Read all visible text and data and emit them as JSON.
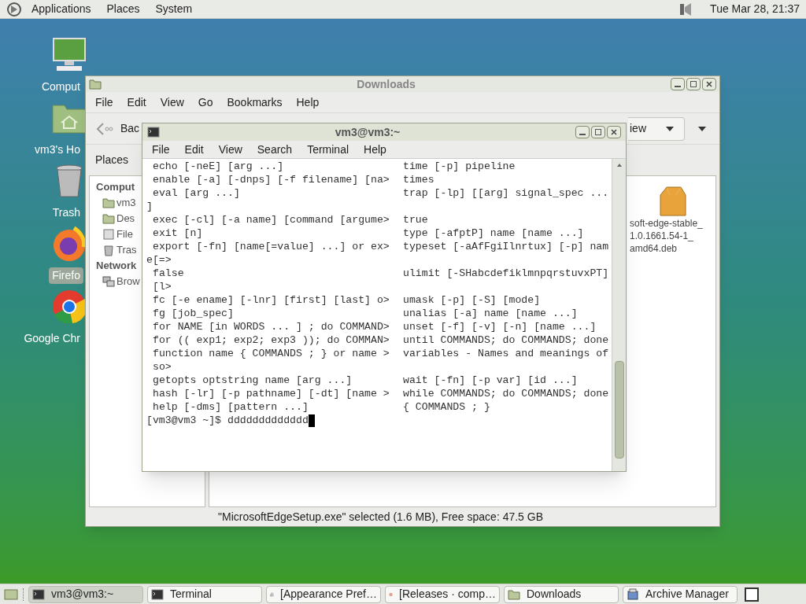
{
  "top_panel": {
    "menus": [
      "Applications",
      "Places",
      "System"
    ],
    "clock": "Tue Mar 28, 21:37"
  },
  "desktop_icons": [
    {
      "kind": "computer",
      "label": "Comput",
      "selected": false
    },
    {
      "kind": "home",
      "label": "vm3's Ho",
      "selected": false
    },
    {
      "kind": "trash",
      "label": "Trash",
      "selected": false
    },
    {
      "kind": "firefox",
      "label": "Firefo",
      "selected": true
    },
    {
      "kind": "chrome",
      "label": "Google Chr",
      "selected": false
    }
  ],
  "file_manager": {
    "title": "Downloads",
    "menu": [
      "File",
      "Edit",
      "View",
      "Go",
      "Bookmarks",
      "Help"
    ],
    "toolbar": {
      "back": "Bac",
      "view": "iew"
    },
    "places_label": "Places",
    "sidebar": [
      {
        "kind": "header",
        "label": "Comput"
      },
      {
        "kind": "home",
        "label": "vm3"
      },
      {
        "kind": "desktop",
        "label": "Des"
      },
      {
        "kind": "drive",
        "label": "File"
      },
      {
        "kind": "trash",
        "label": "Tras"
      },
      {
        "kind": "header",
        "label": "Network"
      },
      {
        "kind": "network",
        "label": "Brow"
      }
    ],
    "files": [
      {
        "label_lines": [
          "soft-edge-stable_",
          "1.0.1661.54-1_",
          "amd64.deb"
        ]
      }
    ],
    "status": "\"MicrosoftEdgeSetup.exe\" selected (1.6 MB), Free space: 47.5 GB"
  },
  "terminal": {
    "title": "vm3@vm3:~",
    "menu": [
      "File",
      "Edit",
      "View",
      "Search",
      "Terminal",
      "Help"
    ],
    "lines": [
      {
        "kind": "pair",
        "left": "echo [-neE] [arg ...]",
        "right": "time [-p] pipeline"
      },
      {
        "kind": "pair",
        "left": "enable [-a] [-dnps] [-f filename] [na>",
        "right": "times"
      },
      {
        "kind": "pair",
        "left": "eval [arg ...]",
        "right": "trap [-lp] [[arg] signal_spec ..."
      },
      {
        "kind": "wrap",
        "text": "]"
      },
      {
        "kind": "pair",
        "left": "exec [-cl] [-a name] [command [argume>",
        "right": "true"
      },
      {
        "kind": "pair",
        "left": "exit [n]",
        "right": "type [-afptP] name [name ...]"
      },
      {
        "kind": "pair",
        "left": "export [-fn] [name[=value] ...] or ex>",
        "right": "typeset [-aAfFgiIlnrtux] [-p] nam"
      },
      {
        "kind": "wrap",
        "text": "e[=>"
      },
      {
        "kind": "pair",
        "left": "false",
        "right": "ulimit [-SHabcdefiklmnpqrstuvxPT]"
      },
      {
        "kind": "wrap_indent",
        "text": "[l>"
      },
      {
        "kind": "pair",
        "left": "fc [-e ename] [-lnr] [first] [last] o>",
        "right": "umask [-p] [-S] [mode]"
      },
      {
        "kind": "pair",
        "left": "fg [job_spec]",
        "right": "unalias [-a] name [name ...]"
      },
      {
        "kind": "pair",
        "left": "for NAME [in WORDS ... ] ; do COMMAND>",
        "right": "unset [-f] [-v] [-n] [name ...]"
      },
      {
        "kind": "pair",
        "left": "for (( exp1; exp2; exp3 )); do COMMAN>",
        "right": "until COMMANDS; do COMMANDS; done"
      },
      {
        "kind": "pair",
        "left": "function name { COMMANDS ; } or name >",
        "right": "variables - Names and meanings of"
      },
      {
        "kind": "wrap_indent",
        "text": "so>"
      },
      {
        "kind": "pair",
        "left": "getopts optstring name [arg ...]",
        "right": "wait [-fn] [-p var] [id ...]"
      },
      {
        "kind": "pair",
        "left": "hash [-lr] [-p pathname] [-dt] [name >",
        "right": "while COMMANDS; do COMMANDS; done"
      },
      {
        "kind": "pair",
        "left": "help [-dms] [pattern ...]",
        "right": "{ COMMANDS ; }"
      }
    ],
    "prompt": "[vm3@vm3 ~]$",
    "input": "ddddddddddddd"
  },
  "taskbar": [
    {
      "kind": "terminal",
      "label": "vm3@vm3:~",
      "selected": true
    },
    {
      "kind": "terminal",
      "label": "Terminal",
      "selected": false
    },
    {
      "kind": "appearance",
      "label": "[Appearance Pref…",
      "selected": false
    },
    {
      "kind": "firefox",
      "label": "[Releases · comp…",
      "selected": false
    },
    {
      "kind": "folder",
      "label": "Downloads",
      "selected": false
    },
    {
      "kind": "archive",
      "label": "Archive Manager",
      "selected": false
    }
  ]
}
